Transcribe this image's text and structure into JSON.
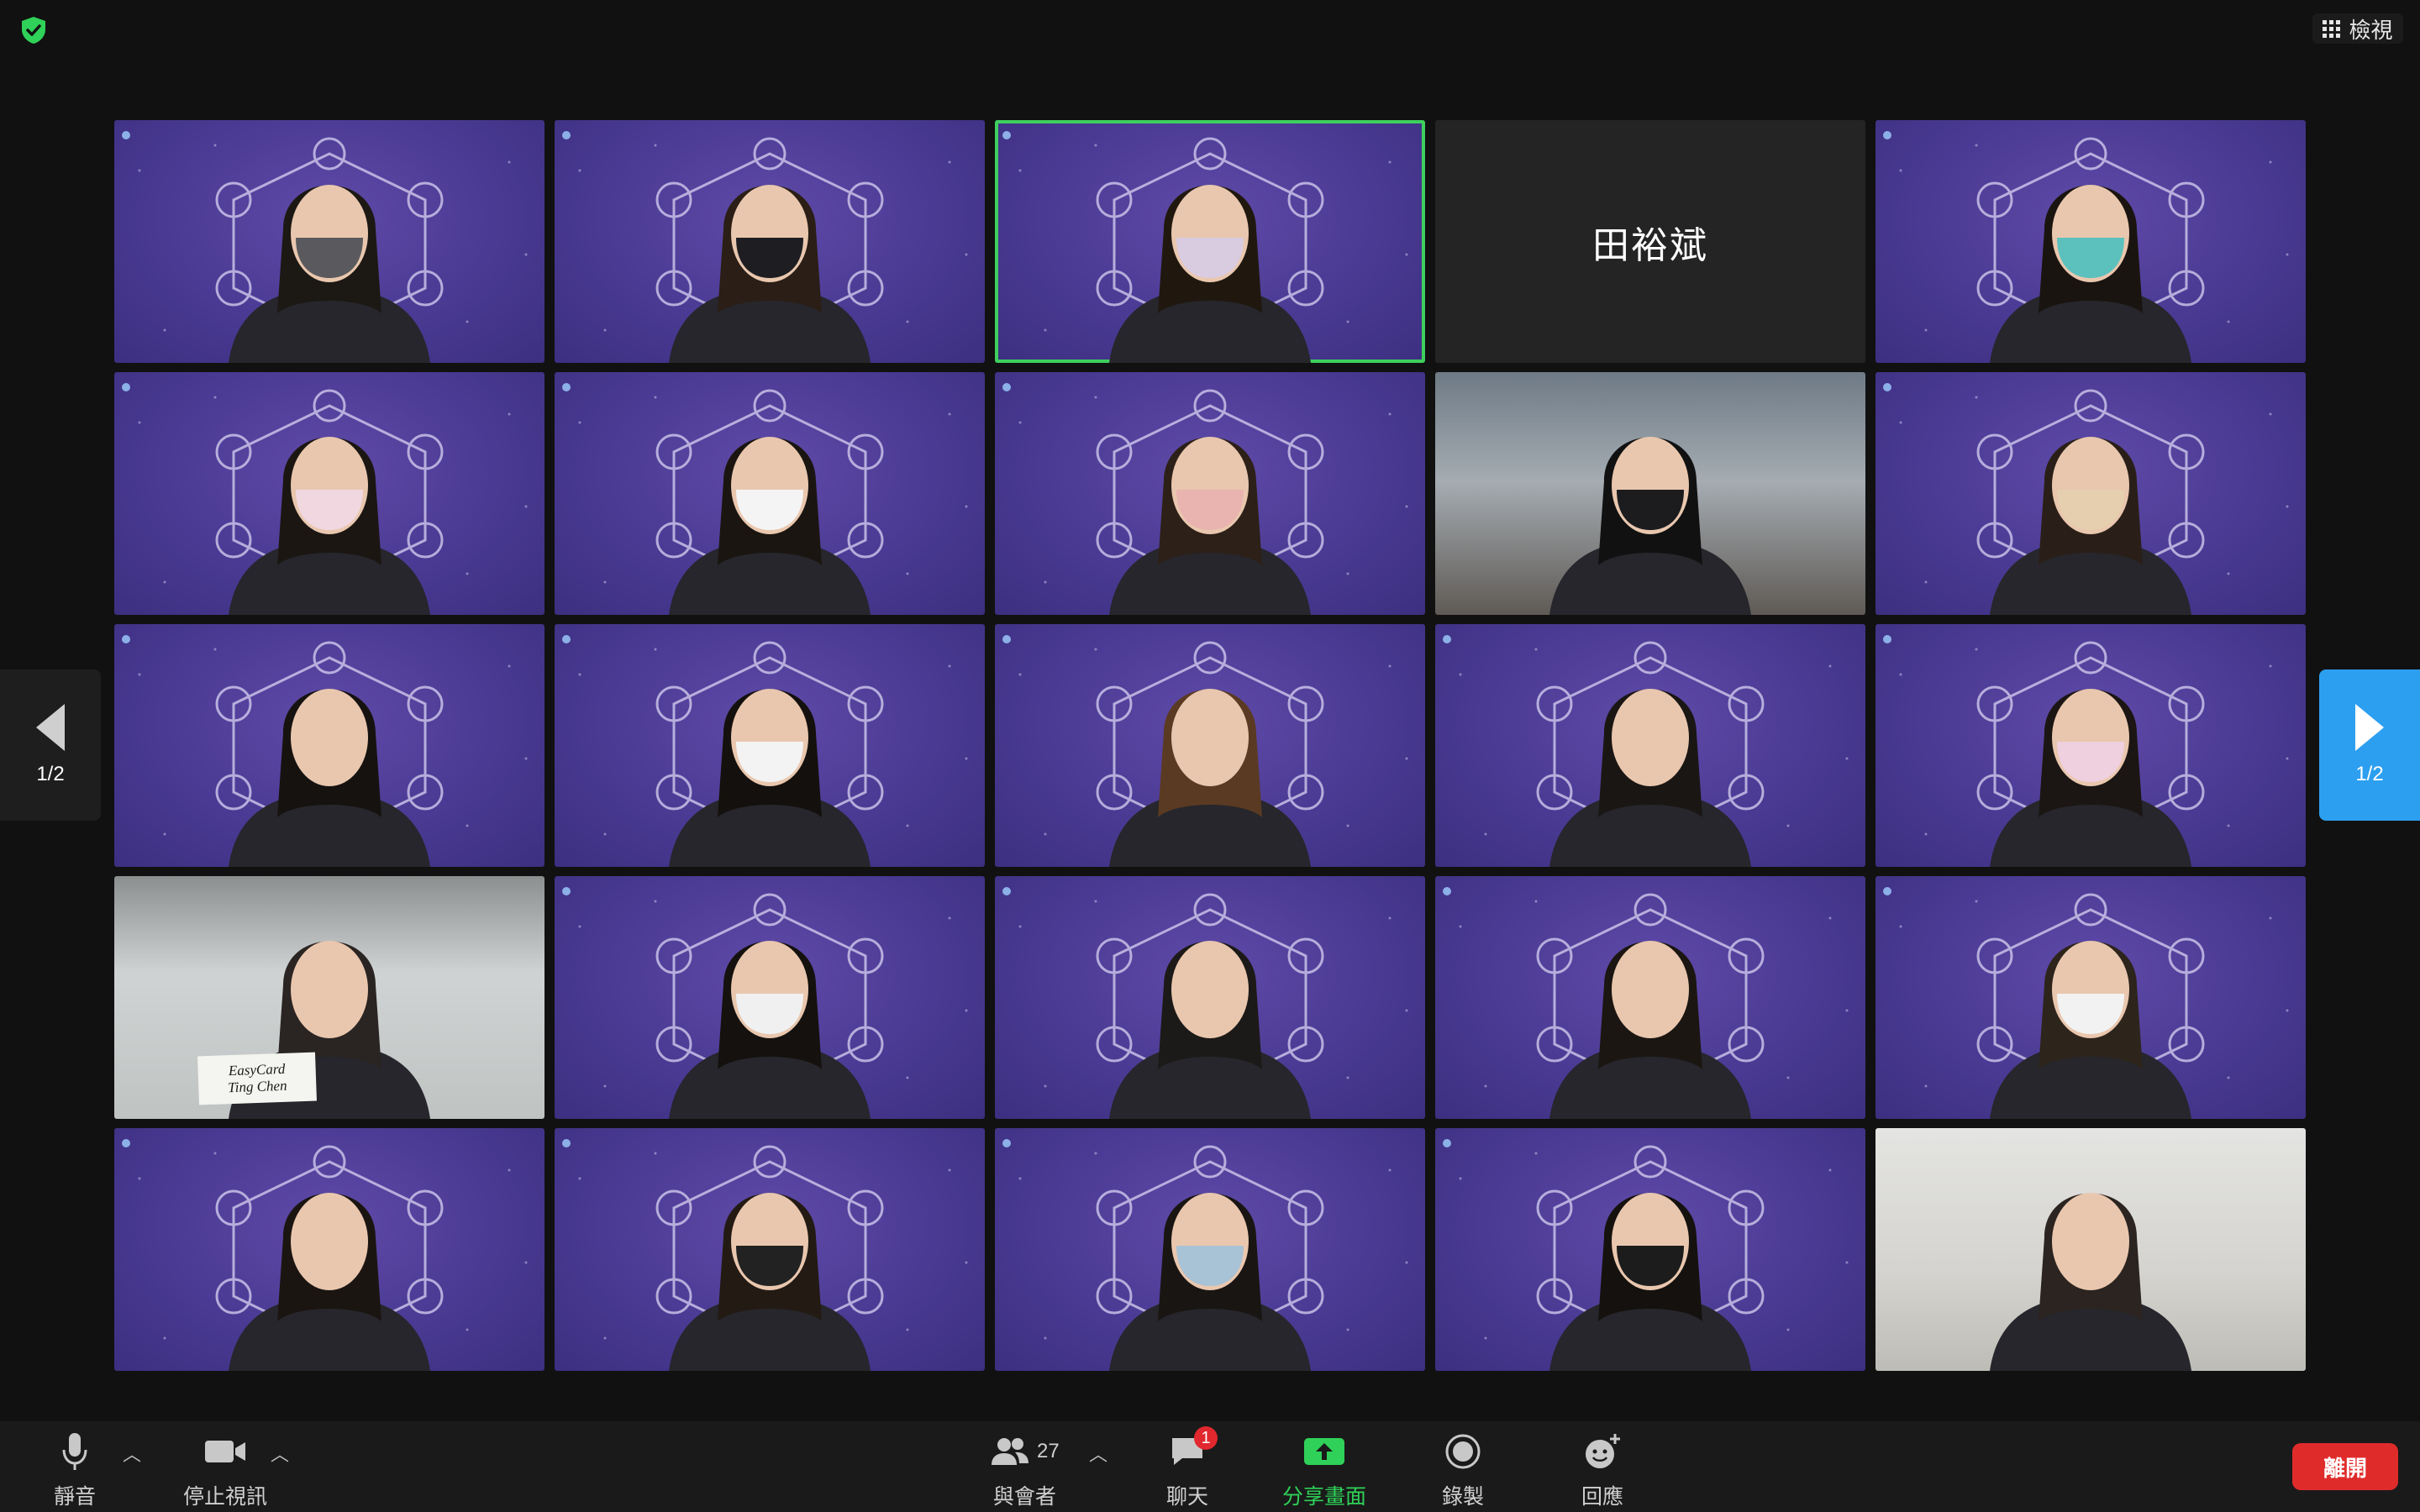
{
  "window": {
    "view_label": "檢視",
    "security_icon": "shield-check-icon",
    "accent_color": "#3ecf5e"
  },
  "gallery": {
    "page_indicator_left": "1/2",
    "page_indicator_right": "1/2",
    "tiles": [
      {
        "kind": "video",
        "bg": "event"
      },
      {
        "kind": "video",
        "bg": "event"
      },
      {
        "kind": "video",
        "bg": "event",
        "active_speaker": true
      },
      {
        "kind": "name",
        "name": "田裕斌"
      },
      {
        "kind": "video",
        "bg": "event"
      },
      {
        "kind": "video",
        "bg": "event"
      },
      {
        "kind": "video",
        "bg": "event"
      },
      {
        "kind": "video",
        "bg": "event"
      },
      {
        "kind": "video",
        "bg": "office"
      },
      {
        "kind": "video",
        "bg": "event"
      },
      {
        "kind": "video",
        "bg": "event"
      },
      {
        "kind": "video",
        "bg": "event"
      },
      {
        "kind": "video",
        "bg": "event"
      },
      {
        "kind": "video",
        "bg": "event"
      },
      {
        "kind": "video",
        "bg": "event"
      },
      {
        "kind": "video",
        "bg": "room",
        "placard": [
          "EasyCard",
          "Ting Chen"
        ]
      },
      {
        "kind": "video",
        "bg": "event"
      },
      {
        "kind": "video",
        "bg": "event"
      },
      {
        "kind": "video",
        "bg": "event"
      },
      {
        "kind": "video",
        "bg": "event"
      },
      {
        "kind": "video",
        "bg": "event"
      },
      {
        "kind": "video",
        "bg": "event"
      },
      {
        "kind": "video",
        "bg": "event"
      },
      {
        "kind": "video",
        "bg": "event"
      },
      {
        "kind": "video",
        "bg": "home"
      }
    ]
  },
  "toolbar": {
    "mute_label": "靜音",
    "video_label": "停止視訊",
    "participants_label": "與會者",
    "participants_count": "27",
    "chat_label": "聊天",
    "chat_badge": "1",
    "share_label": "分享畫面",
    "record_label": "錄製",
    "reactions_label": "回應",
    "leave_label": "離開",
    "share_color": "#2fd158",
    "leave_color": "#e02b2b"
  }
}
